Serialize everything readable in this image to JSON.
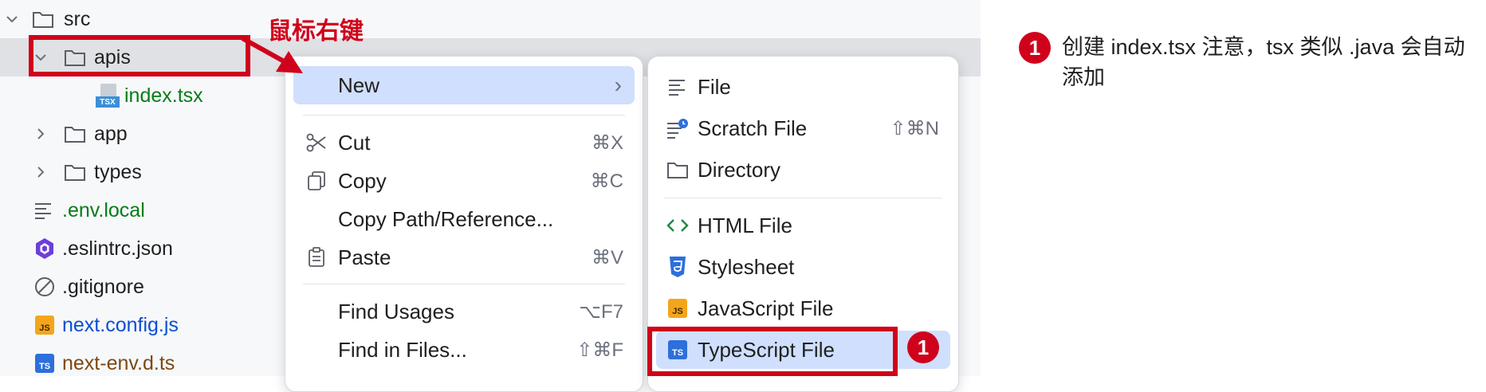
{
  "tree": {
    "items": [
      {
        "label": "src"
      },
      {
        "label": "apis"
      },
      {
        "label": "index.tsx"
      },
      {
        "label": "app"
      },
      {
        "label": "types"
      },
      {
        "label": ".env.local"
      },
      {
        "label": ".eslintrc.json"
      },
      {
        "label": ".gitignore"
      },
      {
        "label": "next.config.js",
        "badge": "JS"
      },
      {
        "label": "next-env.d.ts",
        "badge": "TS"
      }
    ]
  },
  "annotations": {
    "right_click": "鼠标右键",
    "step_number": "1",
    "note": "创建 index.tsx 注意，tsx 类似 .java 会自动添加"
  },
  "context_menu": {
    "items": [
      {
        "label": "New",
        "submenu_arrow": "›"
      },
      {
        "label": "Cut",
        "shortcut": "⌘X"
      },
      {
        "label": "Copy",
        "shortcut": "⌘C"
      },
      {
        "label": "Copy Path/Reference..."
      },
      {
        "label": "Paste",
        "shortcut": "⌘V"
      },
      {
        "label": "Find Usages",
        "shortcut": "⌥F7"
      },
      {
        "label": "Find in Files...",
        "shortcut": "⇧⌘F"
      }
    ]
  },
  "submenu": {
    "items": [
      {
        "label": "File"
      },
      {
        "label": "Scratch File",
        "shortcut": "⇧⌘N"
      },
      {
        "label": "Directory"
      },
      {
        "label": "HTML File"
      },
      {
        "label": "Stylesheet"
      },
      {
        "label": "JavaScript File",
        "badge": "JS"
      },
      {
        "label": "TypeScript File",
        "badge": "TS"
      }
    ]
  },
  "colors": {
    "accent_red": "#d0021b",
    "selection_bg": "#dfe1e5",
    "menu_highlight": "#cfdffd",
    "vcs_added_green": "#067d17",
    "vcs_modified_blue": "#0b4fd1"
  }
}
